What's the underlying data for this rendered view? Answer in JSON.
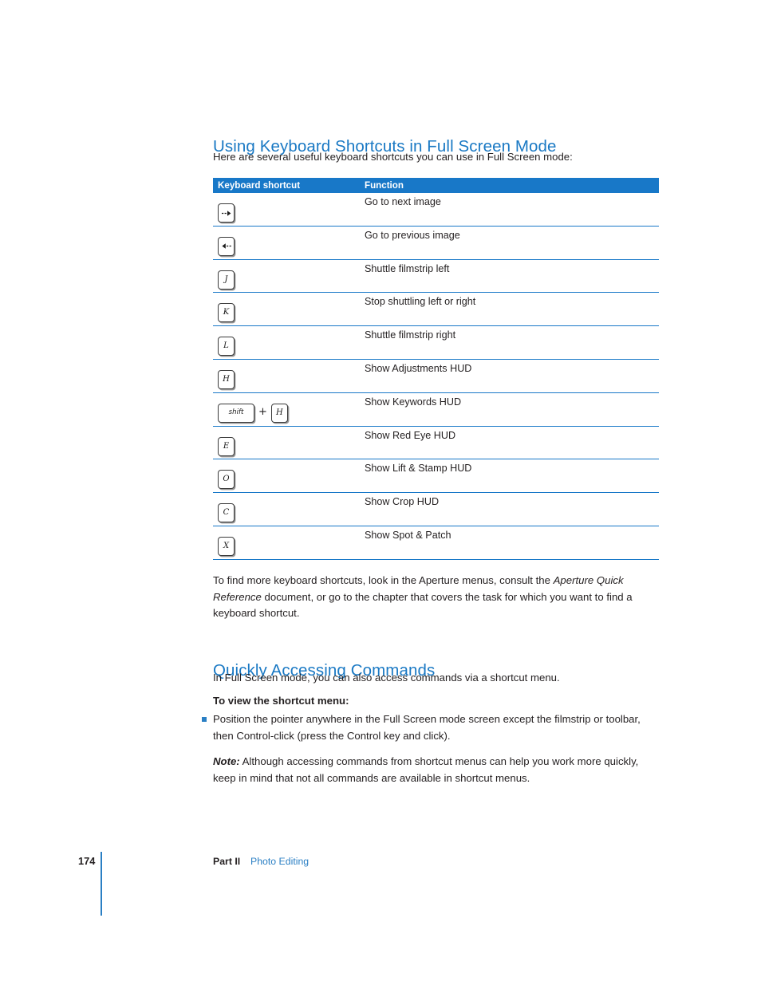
{
  "section1": {
    "heading": "Using Keyboard Shortcuts in Full Screen Mode",
    "intro": "Here are several useful keyboard shortcuts you can use in Full Screen mode:"
  },
  "table": {
    "columns": [
      "Keyboard shortcut",
      "Function"
    ],
    "header_bg": "#1878c8",
    "rule_color": "#1878c8",
    "rows": [
      {
        "keys": [
          {
            "type": "arrow-right",
            "label": "⇢"
          }
        ],
        "function": "Go to next image"
      },
      {
        "keys": [
          {
            "type": "arrow-left",
            "label": "⇠"
          }
        ],
        "function": "Go to previous image"
      },
      {
        "keys": [
          {
            "type": "letter",
            "label": "J"
          }
        ],
        "function": "Shuttle filmstrip left"
      },
      {
        "keys": [
          {
            "type": "letter",
            "label": "K"
          }
        ],
        "function": "Stop shuttling left or right"
      },
      {
        "keys": [
          {
            "type": "letter",
            "label": "L"
          }
        ],
        "function": "Shuttle filmstrip right"
      },
      {
        "keys": [
          {
            "type": "letter",
            "label": "H"
          }
        ],
        "function": "Show Adjustments HUD"
      },
      {
        "keys": [
          {
            "type": "wide",
            "label": "shift"
          },
          {
            "type": "plus",
            "label": "+"
          },
          {
            "type": "letter",
            "label": "H"
          }
        ],
        "function": "Show Keywords HUD"
      },
      {
        "keys": [
          {
            "type": "letter",
            "label": "E"
          }
        ],
        "function": "Show Red Eye HUD"
      },
      {
        "keys": [
          {
            "type": "letter",
            "label": "O"
          }
        ],
        "function": "Show Lift & Stamp HUD"
      },
      {
        "keys": [
          {
            "type": "letter",
            "label": "C"
          }
        ],
        "function": "Show Crop HUD"
      },
      {
        "keys": [
          {
            "type": "letter",
            "label": "X"
          }
        ],
        "function": "Show Spot & Patch"
      }
    ]
  },
  "paragraphs": {
    "find_more_1": "To find more keyboard shortcuts, look in the Aperture menus, consult the ",
    "find_more_italic": "Aperture Quick Reference",
    "find_more_2": " document, or go to the chapter that covers the task for which you want to find a keyboard shortcut."
  },
  "section2": {
    "heading": "Quickly Accessing Commands",
    "intro": "In Full Screen mode, you can also access commands via a shortcut menu.",
    "task_heading": "To view the shortcut menu:",
    "bullet": "Position the pointer anywhere in the Full Screen mode screen except the filmstrip or toolbar, then Control-click (press the Control key and click).",
    "note_label": "Note:",
    "note_text": " Although accessing commands from shortcut menus can help you work more quickly, keep in mind that not all commands are available in shortcut menus."
  },
  "footer": {
    "page_number": "174",
    "part": "Part II",
    "section": "Photo Editing",
    "accent_color": "#2a7fc4"
  }
}
